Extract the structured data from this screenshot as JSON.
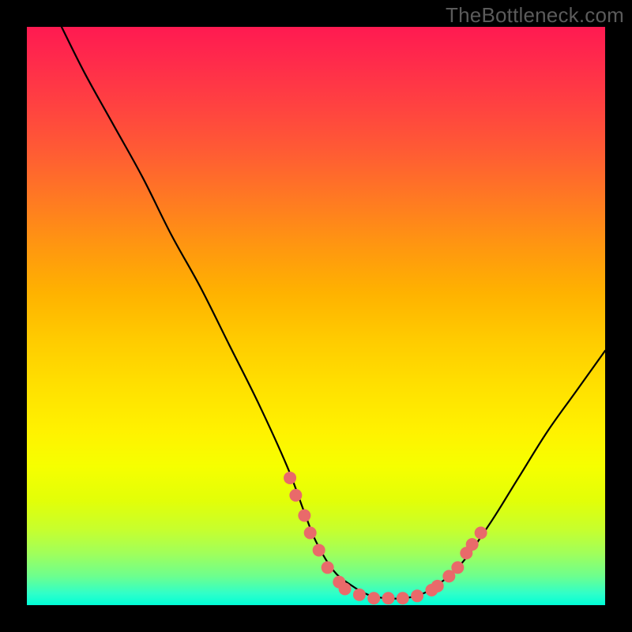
{
  "watermark": "TheBottleneck.com",
  "chart_data": {
    "type": "line",
    "title": "",
    "xlabel": "",
    "ylabel": "",
    "xlim": [
      0,
      100
    ],
    "ylim": [
      0,
      100
    ],
    "series": [
      {
        "name": "curve",
        "x": [
          6,
          10,
          15,
          20,
          25,
          30,
          35,
          40,
          45,
          48,
          50,
          53,
          56,
          59,
          62,
          65,
          68,
          71,
          75,
          80,
          85,
          90,
          95,
          100
        ],
        "y": [
          100,
          92,
          83,
          74,
          64,
          55,
          45,
          35,
          24,
          16,
          11,
          6,
          3.5,
          1.8,
          1.2,
          1.2,
          1.8,
          3.5,
          7,
          14,
          22,
          30,
          37,
          44
        ]
      }
    ],
    "markers": {
      "name": "dots",
      "color": "#e96a6a",
      "points": [
        {
          "x": 45.5,
          "y": 22.0
        },
        {
          "x": 46.5,
          "y": 19.0
        },
        {
          "x": 48.0,
          "y": 15.5
        },
        {
          "x": 49.0,
          "y": 12.5
        },
        {
          "x": 50.5,
          "y": 9.5
        },
        {
          "x": 52.0,
          "y": 6.5
        },
        {
          "x": 54.0,
          "y": 4.0
        },
        {
          "x": 55.0,
          "y": 2.8
        },
        {
          "x": 57.5,
          "y": 1.8
        },
        {
          "x": 60.0,
          "y": 1.2
        },
        {
          "x": 62.5,
          "y": 1.2
        },
        {
          "x": 65.0,
          "y": 1.2
        },
        {
          "x": 67.5,
          "y": 1.6
        },
        {
          "x": 70.0,
          "y": 2.6
        },
        {
          "x": 71.0,
          "y": 3.3
        },
        {
          "x": 73.0,
          "y": 5.0
        },
        {
          "x": 74.5,
          "y": 6.5
        },
        {
          "x": 76.0,
          "y": 9.0
        },
        {
          "x": 77.0,
          "y": 10.5
        },
        {
          "x": 78.5,
          "y": 12.5
        }
      ]
    }
  }
}
